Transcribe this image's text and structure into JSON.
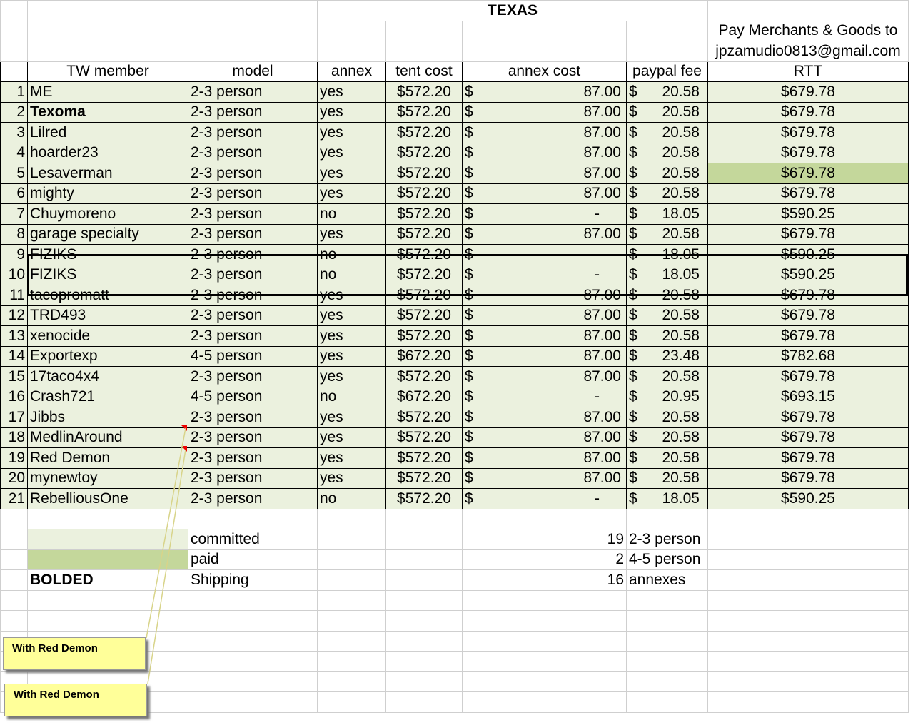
{
  "title": "TEXAS",
  "pay_note_line1": "Pay Merchants & Goods  to",
  "pay_note_line2": "jpzamudio0813@gmail.com",
  "headers": [
    "TW member",
    "model",
    "annex",
    "tent cost",
    "annex cost",
    "paypal fee",
    "RTT"
  ],
  "currency": "$",
  "rows": [
    {
      "n": "1",
      "member": "ME",
      "model": "2-3 person",
      "annex": "yes",
      "tent": "$572.20",
      "annex_cost": "87.00",
      "fee": "20.58",
      "rtt": "$679.78"
    },
    {
      "n": "2",
      "member": "Texoma",
      "model": "2-3 person",
      "annex": "yes",
      "tent": "$572.20",
      "annex_cost": "87.00",
      "fee": "20.58",
      "rtt": "$679.78",
      "bold": true
    },
    {
      "n": "3",
      "member": "Lilred",
      "model": "2-3 person",
      "annex": "yes",
      "tent": "$572.20",
      "annex_cost": "87.00",
      "fee": "20.58",
      "rtt": "$679.78"
    },
    {
      "n": "4",
      "member": "hoarder23",
      "model": "2-3 person",
      "annex": "yes",
      "tent": "$572.20",
      "annex_cost": "87.00",
      "fee": "20.58",
      "rtt": "$679.78"
    },
    {
      "n": "5",
      "member": "Lesaverman",
      "model": "2-3 person",
      "annex": "yes",
      "tent": "$572.20",
      "annex_cost": "87.00",
      "fee": "20.58",
      "rtt": "$679.78",
      "paid": true
    },
    {
      "n": "6",
      "member": "mighty",
      "model": "2-3 person",
      "annex": "yes",
      "tent": "$572.20",
      "annex_cost": "87.00",
      "fee": "20.58",
      "rtt": "$679.78"
    },
    {
      "n": "7",
      "member": "Chuymoreno",
      "model": "2-3 person",
      "annex": "no",
      "tent": "$572.20",
      "annex_cost": "-",
      "fee": "18.05",
      "rtt": "$590.25"
    },
    {
      "n": "8",
      "member": "garage specialty",
      "model": "2-3 person",
      "annex": "yes",
      "tent": "$572.20",
      "annex_cost": "87.00",
      "fee": "20.58",
      "rtt": "$679.78"
    },
    {
      "n": "9",
      "member": "FIZIKS",
      "model": "2-3 person",
      "annex": "no",
      "tent": "$572.20",
      "annex_cost": "-",
      "fee": "18.05",
      "rtt": "$590.25"
    },
    {
      "n": "10",
      "member": "FIZIKS",
      "model": "2-3 person",
      "annex": "no",
      "tent": "$572.20",
      "annex_cost": "-",
      "fee": "18.05",
      "rtt": "$590.25"
    },
    {
      "n": "11",
      "member": "tacopromatt",
      "model": "2-3 person",
      "annex": "yes",
      "tent": "$572.20",
      "annex_cost": "87.00",
      "fee": "20.58",
      "rtt": "$679.78"
    },
    {
      "n": "12",
      "member": "TRD493",
      "model": "2-3 person",
      "annex": "yes",
      "tent": "$572.20",
      "annex_cost": "87.00",
      "fee": "20.58",
      "rtt": "$679.78"
    },
    {
      "n": "13",
      "member": "xenocide",
      "model": "2-3 person",
      "annex": "yes",
      "tent": "$572.20",
      "annex_cost": "87.00",
      "fee": "20.58",
      "rtt": "$679.78"
    },
    {
      "n": "14",
      "member": "Exportexp",
      "model": "4-5 person",
      "annex": "yes",
      "tent": "$672.20",
      "annex_cost": "87.00",
      "fee": "23.48",
      "rtt": "$782.68"
    },
    {
      "n": "15",
      "member": "17taco4x4",
      "model": "2-3 person",
      "annex": "yes",
      "tent": "$572.20",
      "annex_cost": "87.00",
      "fee": "20.58",
      "rtt": "$679.78"
    },
    {
      "n": "16",
      "member": "Crash721",
      "model": "4-5 person",
      "annex": "no",
      "tent": "$672.20",
      "annex_cost": "-",
      "fee": "20.95",
      "rtt": "$693.15"
    },
    {
      "n": "17",
      "member": "Jibbs",
      "model": "2-3 person",
      "annex": "yes",
      "tent": "$572.20",
      "annex_cost": "87.00",
      "fee": "20.58",
      "rtt": "$679.78"
    },
    {
      "n": "18",
      "member": "MedlinAround",
      "model": "2-3 person",
      "annex": "yes",
      "tent": "$572.20",
      "annex_cost": "87.00",
      "fee": "20.58",
      "rtt": "$679.78"
    },
    {
      "n": "19",
      "member": "Red Demon",
      "model": "2-3 person",
      "annex": "yes",
      "tent": "$572.20",
      "annex_cost": "87.00",
      "fee": "20.58",
      "rtt": "$679.78"
    },
    {
      "n": "20",
      "member": "mynewtoy",
      "model": "2-3 person",
      "annex": "yes",
      "tent": "$572.20",
      "annex_cost": "87.00",
      "fee": "20.58",
      "rtt": "$679.78"
    },
    {
      "n": "21",
      "member": "RebelliousOne",
      "model": "2-3 person",
      "annex": "no",
      "tent": "$572.20",
      "annex_cost": "-",
      "fee": "18.05",
      "rtt": "$590.25"
    }
  ],
  "legend": [
    {
      "label": "committed",
      "count": "19",
      "desc": "2-3 person"
    },
    {
      "label": "paid",
      "count": "2",
      "desc": "4-5 person"
    },
    {
      "label": "Shipping",
      "count": "16",
      "desc": "annexes",
      "swatch_text": "BOLDED"
    }
  ],
  "colors": {
    "committed": "#ebf1de",
    "paid": "#c4d79b",
    "comment": "#ffff99",
    "comment_marker": "#e00000"
  },
  "comments": [
    "With Red Demon",
    "With Red Demon"
  ]
}
